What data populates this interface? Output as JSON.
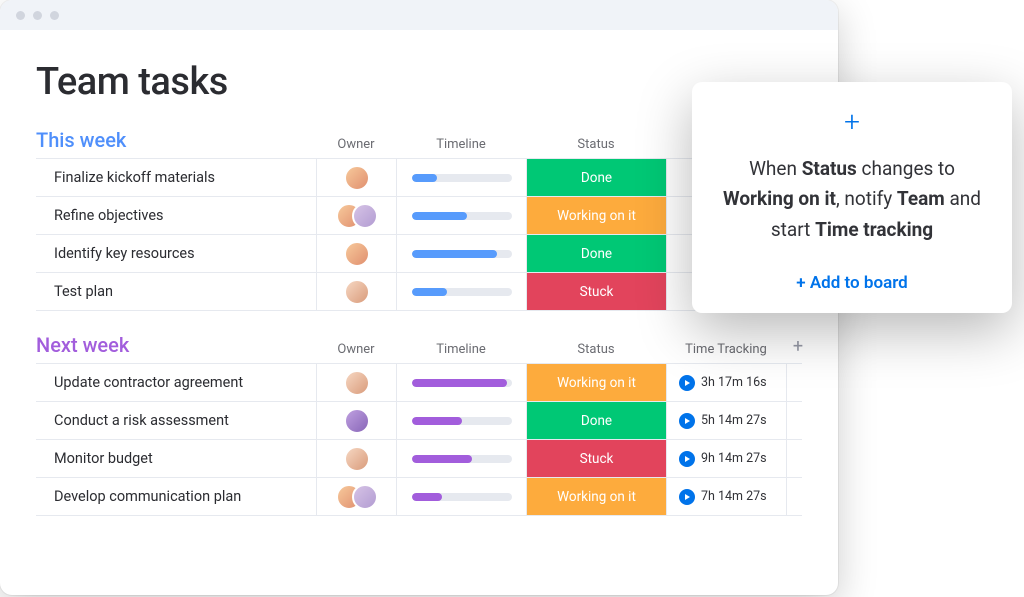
{
  "page_title": "Team tasks",
  "columns": {
    "owner": "Owner",
    "timeline": "Timeline",
    "status": "Status",
    "time_tracking": "Time Tracking"
  },
  "status_colors": {
    "Done": "#00c875",
    "Working on it": "#fdab3d",
    "Stuck": "#e2445c"
  },
  "groups": [
    {
      "id": "this_week",
      "title": "This week",
      "accent": "#579bfc",
      "bar_color": "#579bfc",
      "show_time_tracking": false,
      "rows": [
        {
          "task": "Finalize kickoff materials",
          "owners": [
            "a"
          ],
          "progress": 0.25,
          "status": "Done"
        },
        {
          "task": "Refine objectives",
          "owners": [
            "a",
            "d"
          ],
          "progress": 0.55,
          "status": "Working on it"
        },
        {
          "task": "Identify key resources",
          "owners": [
            "a"
          ],
          "progress": 0.85,
          "status": "Done"
        },
        {
          "task": "Test plan",
          "owners": [
            "c"
          ],
          "progress": 0.35,
          "status": "Stuck"
        }
      ]
    },
    {
      "id": "next_week",
      "title": "Next week",
      "accent": "#a25ddc",
      "bar_color": "#a25ddc",
      "show_time_tracking": true,
      "rows": [
        {
          "task": "Update contractor agreement",
          "owners": [
            "c"
          ],
          "progress": 0.95,
          "status": "Working on it",
          "time": "3h 17m 16s"
        },
        {
          "task": "Conduct a risk assessment",
          "owners": [
            "b"
          ],
          "progress": 0.5,
          "status": "Done",
          "time": "5h 14m 27s"
        },
        {
          "task": "Monitor budget",
          "owners": [
            "c"
          ],
          "progress": 0.6,
          "status": "Stuck",
          "time": "9h 14m 27s"
        },
        {
          "task": "Develop communication plan",
          "owners": [
            "a",
            "d"
          ],
          "progress": 0.3,
          "status": "Working on it",
          "time": "7h 14m 27s"
        }
      ]
    }
  ],
  "automation": {
    "text_parts": [
      "When ",
      "Status",
      " changes to ",
      "Working on it",
      ", notify ",
      "Team",
      " and start ",
      "Time tracking"
    ],
    "bold_indices": [
      1,
      3,
      5,
      7
    ],
    "add_label": "+ Add to board"
  }
}
